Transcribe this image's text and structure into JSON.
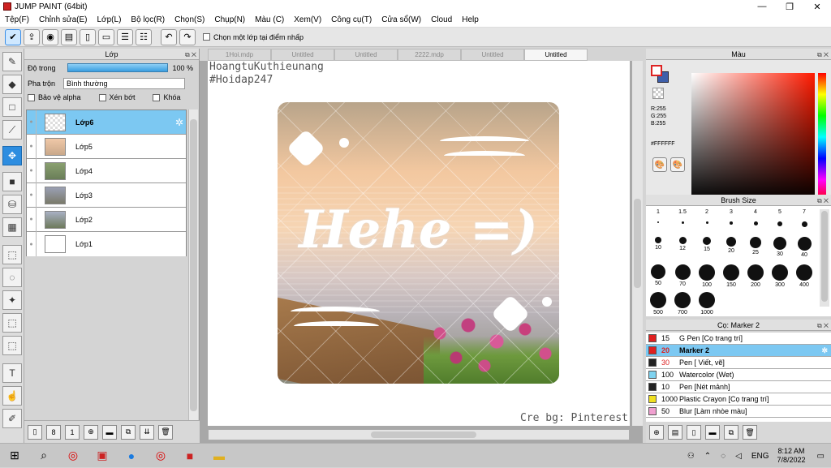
{
  "window": {
    "title": "JUMP PAINT (64bit)",
    "min": "—",
    "max": "❐",
    "close": "✕"
  },
  "menu": [
    "Tệp(F)",
    "Chỉnh sửa(E)",
    "Lớp(L)",
    "Bộ lọc(R)",
    "Chọn(S)",
    "Chụp(N)",
    "Màu (C)",
    "Xem(V)",
    "Công cụ(T)",
    "Cửa sổ(W)",
    "Cloud",
    "Help"
  ],
  "toolbar": {
    "checkbox_label": "Chọn một lớp tại điểm nhấp"
  },
  "layer_panel": {
    "title": "Lớp",
    "opacity_label": "Độ trong",
    "opacity_value": "100 %",
    "blend_label": "Pha trộn",
    "blend_value": "Bình thường",
    "checks": [
      "Bảo vệ alpha",
      "Xén bớt",
      "Khóa"
    ],
    "layers": [
      {
        "name": "Lớp6",
        "selected": true
      },
      {
        "name": "Lớp5",
        "selected": false
      },
      {
        "name": "Lớp4",
        "selected": false
      },
      {
        "name": "Lớp3",
        "selected": false
      },
      {
        "name": "Lớp2",
        "selected": false
      },
      {
        "name": "Lớp1",
        "selected": false
      }
    ]
  },
  "tabs": [
    "1Hoi.mdp",
    "Untitled",
    "Untitled",
    "2222.mdp",
    "Untitled",
    "Untitled"
  ],
  "active_tab": 5,
  "canvas": {
    "watermark_line1": "HoangtuKuthieunang",
    "watermark_line2": "#Hoidap247",
    "credit": "Cre bg: Pinterest",
    "artwork_text": "Hehe =)"
  },
  "color_panel": {
    "title": "Màu",
    "r": "R:255",
    "g": "G:255",
    "b": "B:255",
    "hex": "#FFFFFF",
    "primary": "#ffffff",
    "secondary": "#3e5faa"
  },
  "brush_panel": {
    "title": "Brush Size",
    "sizes": [
      "1",
      "1.5",
      "2",
      "3",
      "4",
      "5",
      "7",
      "10",
      "12",
      "15",
      "20",
      "25",
      "30",
      "40",
      "50",
      "70",
      "100",
      "150",
      "200",
      "300",
      "400",
      "500",
      "700",
      "1000"
    ]
  },
  "tool_panel": {
    "title": "Cọ: Marker 2",
    "items": [
      {
        "size": "15",
        "name": "G Pen [Cọ trang trí]",
        "color": "#e02020",
        "selected": false,
        "sizeRed": false
      },
      {
        "size": "20",
        "name": "Marker 2",
        "color": "#e02020",
        "selected": true,
        "sizeRed": true
      },
      {
        "size": "30",
        "name": "Pen [ Viết, vẽ]",
        "color": "#222222",
        "selected": false,
        "sizeRed": true
      },
      {
        "size": "100",
        "name": "Watercolor (Wet)",
        "color": "#7fd3f0",
        "selected": false,
        "sizeRed": false
      },
      {
        "size": "10",
        "name": "Pen [Nét mảnh]",
        "color": "#222222",
        "selected": false,
        "sizeRed": false
      },
      {
        "size": "1000",
        "name": "Plastic Crayon [Cọ trang trí]",
        "color": "#f0e020",
        "selected": false,
        "sizeRed": false
      },
      {
        "size": "50",
        "name": "Blur [Làm nhòe màu]",
        "color": "#f0a0d0",
        "selected": false,
        "sizeRed": false
      }
    ]
  },
  "taskbar": {
    "lang": "ENG",
    "time": "8:12 AM",
    "date": "7/8/2022"
  }
}
